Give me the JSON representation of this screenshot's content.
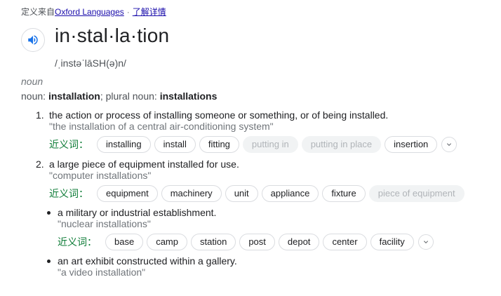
{
  "source": {
    "prefix": "定义来自",
    "link": "Oxford Languages",
    "sep": "·",
    "more": "了解详情"
  },
  "icons": {
    "speaker": "speaker-icon",
    "expand": "chevron-down-icon"
  },
  "headword": "in·stal·la·tion",
  "phonetic": "/ˌinstəˈlāSH(ə)n/",
  "pos": "noun",
  "forms": {
    "label1": "noun",
    "word": "installation",
    "plural_label": "plural noun",
    "plural": "installations"
  },
  "synonym_label": "近义词",
  "senses": [
    {
      "num": "1.",
      "definition": "the action or process of installing someone or something, or of being installed.",
      "example": "\"the installation of a central air-conditioning system\"",
      "synonyms": [
        {
          "text": "installing",
          "disabled": false
        },
        {
          "text": "install",
          "disabled": false
        },
        {
          "text": "fitting",
          "disabled": false
        },
        {
          "text": "putting in",
          "disabled": true
        },
        {
          "text": "putting in place",
          "disabled": true
        },
        {
          "text": "insertion",
          "disabled": false
        }
      ]
    },
    {
      "num": "2.",
      "definition": "a large piece of equipment installed for use.",
      "example": "\"computer installations\"",
      "synonyms": [
        {
          "text": "equipment",
          "disabled": false
        },
        {
          "text": "machinery",
          "disabled": false
        },
        {
          "text": "unit",
          "disabled": false
        },
        {
          "text": "appliance",
          "disabled": false
        },
        {
          "text": "fixture",
          "disabled": false
        },
        {
          "text": "piece of equipment",
          "disabled": true
        }
      ]
    },
    {
      "definition": "a military or industrial establishment.",
      "example": "\"nuclear installations\"",
      "synonyms": [
        {
          "text": "base",
          "disabled": false
        },
        {
          "text": "camp",
          "disabled": false
        },
        {
          "text": "station",
          "disabled": false
        },
        {
          "text": "post",
          "disabled": false
        },
        {
          "text": "depot",
          "disabled": false
        },
        {
          "text": "center",
          "disabled": false
        },
        {
          "text": "facility",
          "disabled": false
        }
      ]
    },
    {
      "definition": "an art exhibit constructed within a gallery.",
      "example": "\"a video installation\""
    }
  ]
}
